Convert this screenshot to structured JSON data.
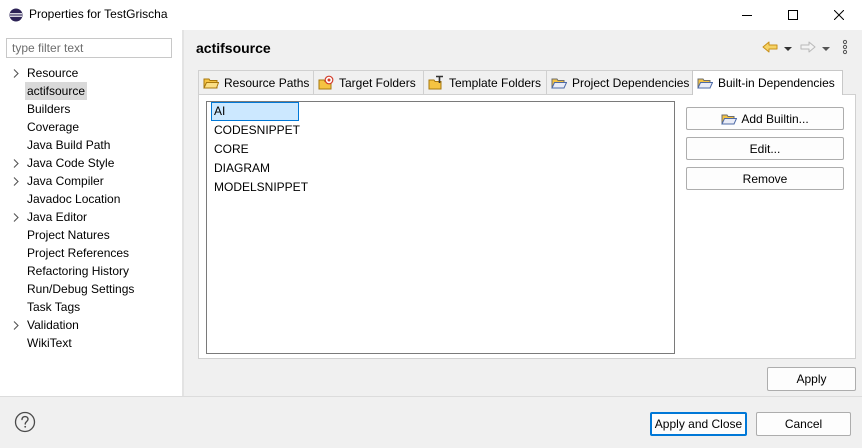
{
  "window": {
    "title": "Properties for TestGrischa",
    "icon": "eclipse-icon",
    "controls": [
      "minimize-icon",
      "maximize-icon",
      "close-icon"
    ]
  },
  "sidebar": {
    "filter_placeholder": "type filter text",
    "filter_value": "",
    "items": [
      {
        "label": "Resource",
        "expandable": true,
        "selected": false
      },
      {
        "label": "actifsource",
        "expandable": false,
        "selected": true
      },
      {
        "label": "Builders",
        "expandable": false,
        "selected": false
      },
      {
        "label": "Coverage",
        "expandable": false,
        "selected": false
      },
      {
        "label": "Java Build Path",
        "expandable": false,
        "selected": false
      },
      {
        "label": "Java Code Style",
        "expandable": true,
        "selected": false
      },
      {
        "label": "Java Compiler",
        "expandable": true,
        "selected": false
      },
      {
        "label": "Javadoc Location",
        "expandable": false,
        "selected": false
      },
      {
        "label": "Java Editor",
        "expandable": true,
        "selected": false
      },
      {
        "label": "Project Natures",
        "expandable": false,
        "selected": false
      },
      {
        "label": "Project References",
        "expandable": false,
        "selected": false
      },
      {
        "label": "Refactoring History",
        "expandable": false,
        "selected": false
      },
      {
        "label": "Run/Debug Settings",
        "expandable": false,
        "selected": false
      },
      {
        "label": "Task Tags",
        "expandable": false,
        "selected": false
      },
      {
        "label": "Validation",
        "expandable": true,
        "selected": false
      },
      {
        "label": "WikiText",
        "expandable": false,
        "selected": false
      }
    ]
  },
  "page": {
    "title": "actifsource",
    "nav_icons": [
      "back-arrow-icon",
      "chevron-down-icon",
      "forward-arrow-icon",
      "chevron-down-icon",
      "more-vertical-icon"
    ]
  },
  "tabs": [
    {
      "label": "Resource Paths",
      "icon": "folder-icon",
      "active": false
    },
    {
      "label": "Target Folders",
      "icon": "target-folder-icon",
      "active": false
    },
    {
      "label": "Template Folders",
      "icon": "template-folder-icon",
      "active": false
    },
    {
      "label": "Project Dependencies",
      "icon": "folder-open-icon",
      "active": false
    },
    {
      "label": "Built-in Dependencies",
      "icon": "folder-open-icon",
      "active": true
    }
  ],
  "builtins": {
    "items": [
      "AI",
      "CODESNIPPET",
      "CORE",
      "DIAGRAM",
      "MODELSNIPPET"
    ],
    "editing_index": 0
  },
  "side_buttons": {
    "add_builtin": "Add Builtin...",
    "edit": "Edit...",
    "remove": "Remove"
  },
  "footer": {
    "apply": "Apply",
    "apply_and_close": "Apply and Close",
    "cancel": "Cancel",
    "help_icon": "help-icon"
  },
  "colors": {
    "accent": "#0078d7",
    "selection_bg": "#cce8ff",
    "tree_selection": "#d9d9d9",
    "nav_arrow": "#e8a81a"
  }
}
